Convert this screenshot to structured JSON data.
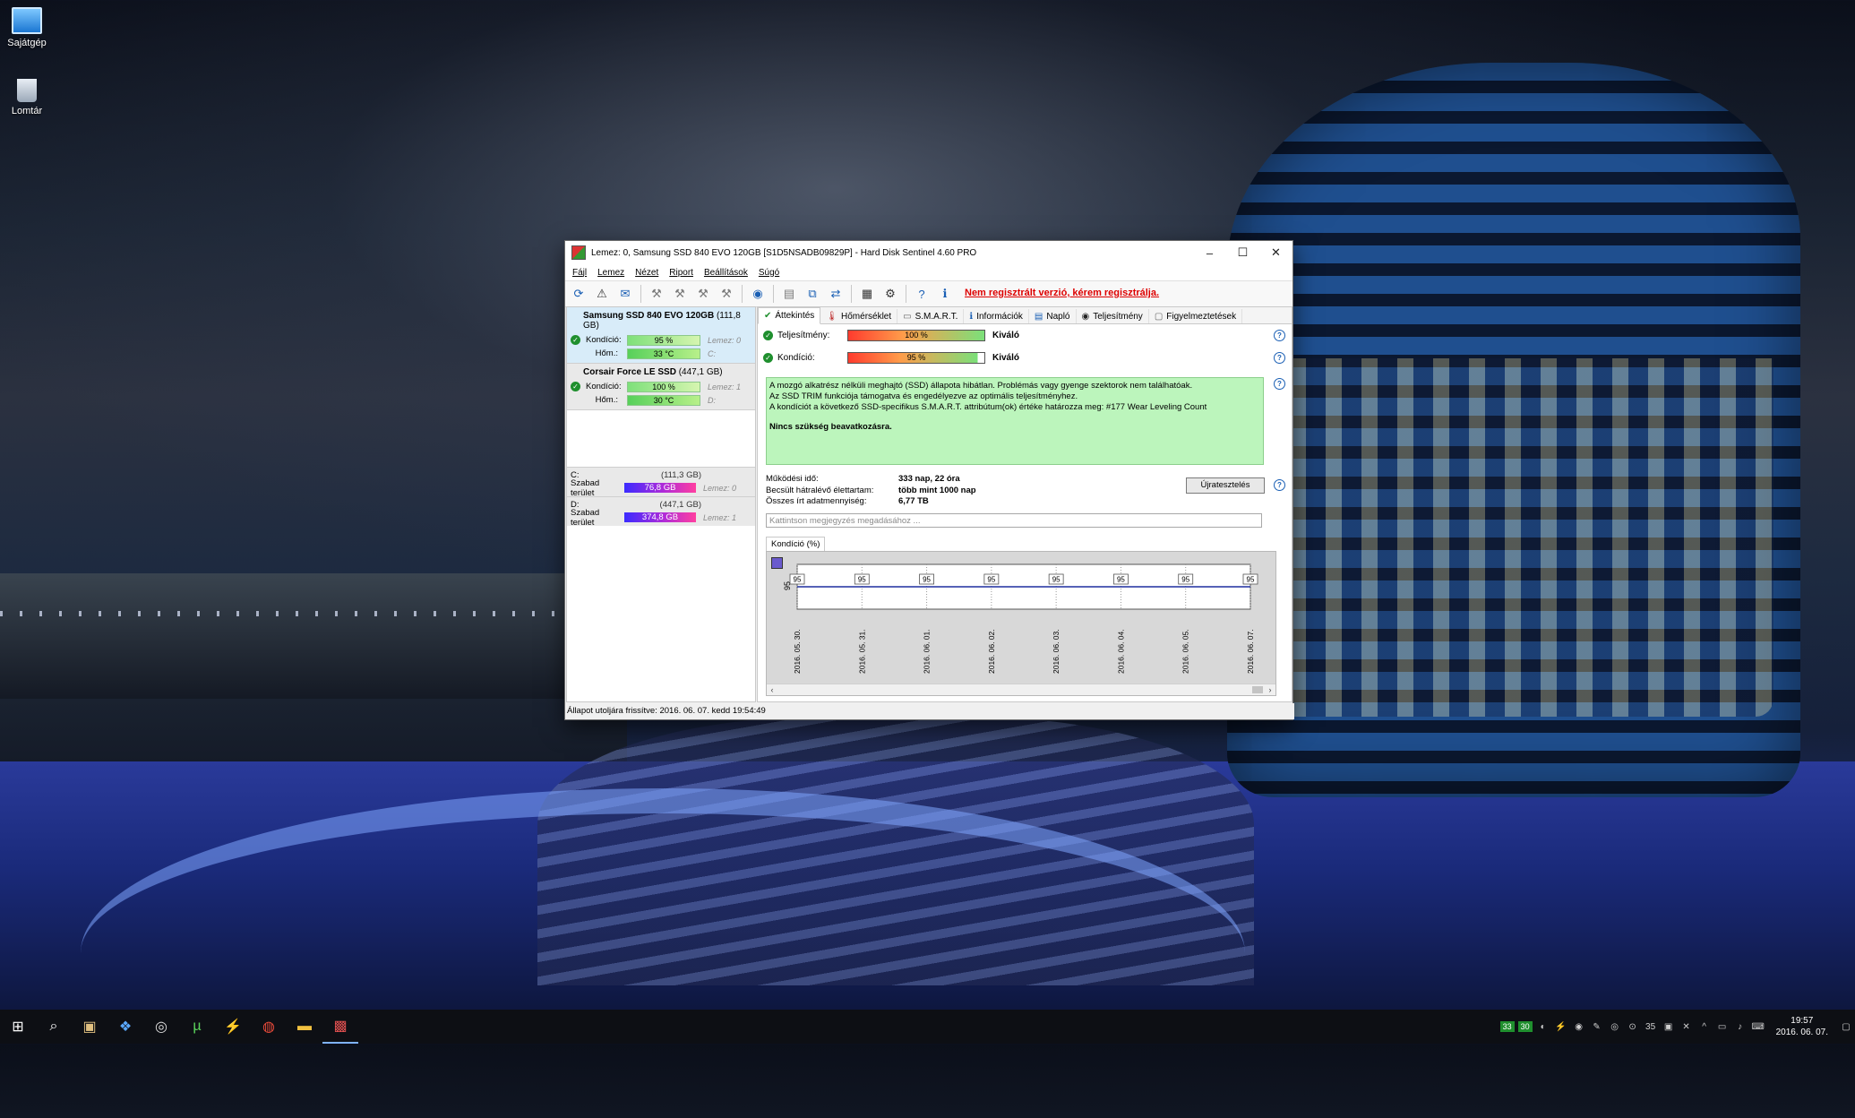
{
  "desktop": {
    "icons": [
      {
        "label": "Sajátgép"
      },
      {
        "label": "Lomtár"
      }
    ]
  },
  "window": {
    "title": "Lemez: 0, Samsung SSD 840 EVO 120GB [S1D5NSADB09829P]  -  Hard Disk Sentinel 4.60 PRO",
    "controls": {
      "minimize": "–",
      "maximize": "☐",
      "close": "✕"
    },
    "menu": [
      "Fájl",
      "Lemez",
      "Nézet",
      "Riport",
      "Beállítások",
      "Súgó"
    ],
    "register_link": "Nem regisztrált verzió, kérem regisztrálja.",
    "disks": [
      {
        "name": "Samsung SSD 840 EVO 120GB",
        "size": "(111,8 GB)",
        "condition_label": "Kondíció:",
        "condition_value": "95 %",
        "condition_aux": "Lemez: 0",
        "temp_label": "Hőm.:",
        "temp_value": "33 °C",
        "temp_aux": "C:"
      },
      {
        "name": "Corsair Force LE SSD",
        "size": "(447,1 GB)",
        "condition_label": "Kondíció:",
        "condition_value": "100 %",
        "condition_aux": "Lemez: 1",
        "temp_label": "Hőm.:",
        "temp_value": "30 °C",
        "temp_aux": "D:"
      }
    ],
    "partitions": [
      {
        "name": "C:",
        "size": "(111,3 GB)",
        "free_label": "Szabad terület",
        "free_value": "76,8 GB",
        "aux": "Lemez: 0"
      },
      {
        "name": "D:",
        "size": "(447,1 GB)",
        "free_label": "Szabad terület",
        "free_value": "374,8 GB",
        "aux": "Lemez: 1"
      }
    ],
    "tabs": [
      "Áttekintés",
      "Hőmérséklet",
      "S.M.A.R.T.",
      "Információk",
      "Napló",
      "Teljesítmény",
      "Figyelmeztetések"
    ],
    "performance": {
      "label": "Teljesítmény:",
      "value": "100 %",
      "fill": 1.0,
      "verdict": "Kiváló"
    },
    "condition": {
      "label": "Kondíció:",
      "value": "95 %",
      "fill": 0.95,
      "verdict": "Kiváló"
    },
    "info_lines": [
      "A mozgó alkatrész nélküli meghajtó (SSD) állapota hibátlan. Problémás vagy gyenge szektorok nem találhatóak.",
      "Az SSD TRIM funkciója támogatva és engedélyezve az optimális teljesítményhez.",
      "A kondíciót a következő SSD-specifikus S.M.A.R.T. attribútum(ok) értéke határozza meg:  #177 Wear Leveling Count"
    ],
    "info_strong": "Nincs szükség beavatkozásra.",
    "facts": [
      {
        "k": "Működési idő:",
        "v": "333 nap, 22 óra"
      },
      {
        "k": "Becsült hátralévő élettartam:",
        "v": "több mint 1000 nap"
      },
      {
        "k": "Összes írt adatmennyiség:",
        "v": "6,77 TB"
      }
    ],
    "retest_button": "Újratesztelés",
    "note_placeholder": "Kattintson megjegyzés megadásához ...",
    "chart_tab": "Kondíció  (%)",
    "statusbar": "Állapot utoljára frissítve: 2016. 06. 07. kedd 19:54:49"
  },
  "chart_data": {
    "type": "line",
    "title": "",
    "xlabel": "",
    "ylabel": "95",
    "x": [
      "2016. 05. 30.",
      "2016. 05. 31.",
      "2016. 06. 01.",
      "2016. 06. 02.",
      "2016. 06. 03.",
      "2016. 06. 04.",
      "2016. 06. 05.",
      "2016. 06. 07."
    ],
    "series": [
      {
        "values": [
          95,
          95,
          95,
          95,
          95,
          95,
          95,
          95
        ]
      }
    ],
    "ylim": [
      94,
      96
    ],
    "line_color": "#1f2f9f"
  },
  "taskbar": {
    "icons": [
      "start-icon",
      "search-icon",
      "explorer-icon",
      "edge-icon",
      "media-icon",
      "utorrent-icon",
      "winamp-icon",
      "chrome-icon",
      "folder-icon",
      "hd-sentinel-icon"
    ],
    "tray_numbers": [
      "33",
      "30"
    ],
    "tray_temp": "35",
    "time": "19:57",
    "date": "2016. 06. 07."
  }
}
